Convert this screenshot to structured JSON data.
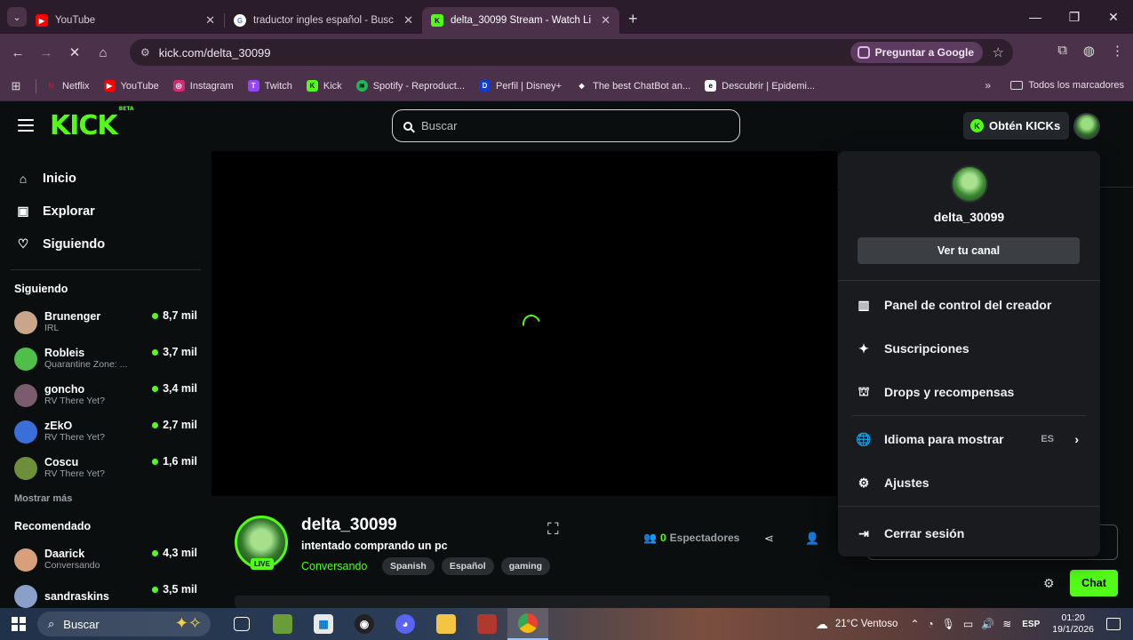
{
  "browser": {
    "tabs": [
      {
        "title": "YouTube",
        "icon": "youtube-icon",
        "color": "#ff0000",
        "active": false
      },
      {
        "title": "traductor ingles español - Busc",
        "icon": "google-icon",
        "color": "#4285f4",
        "active": false
      },
      {
        "title": "delta_30099 Stream - Watch Li",
        "icon": "kick-icon",
        "color": "#53fc18",
        "active": true
      }
    ],
    "new_tab": "+",
    "url": "kick.com/delta_30099",
    "ask_google": "Preguntar a Google",
    "bookmarks": [
      {
        "label": "Netflix",
        "icon": "netflix-icon",
        "color": "#e50914"
      },
      {
        "label": "YouTube",
        "icon": "youtube-icon",
        "color": "#ff0000"
      },
      {
        "label": "Instagram",
        "icon": "instagram-icon",
        "color": "#d62976"
      },
      {
        "label": "Twitch",
        "icon": "twitch-icon",
        "color": "#9146ff"
      },
      {
        "label": "Kick",
        "icon": "kick-icon",
        "color": "#53fc18"
      },
      {
        "label": "Spotify - Reproduct...",
        "icon": "spotify-icon",
        "color": "#1db954"
      },
      {
        "label": "Perfil | Disney+",
        "icon": "disney-icon",
        "color": "#113ccf"
      },
      {
        "label": "The best ChatBot an...",
        "icon": "chatbot-icon",
        "color": "#ffffff"
      },
      {
        "label": "Descubrir | Epidemi...",
        "icon": "epidemic-icon",
        "color": "#ffffff"
      }
    ],
    "all_bookmarks": "Todos los marcadores"
  },
  "kick": {
    "search_placeholder": "Buscar",
    "get_kicks": "Obtén KICKs",
    "nav": [
      {
        "label": "Inicio",
        "icon": "home-icon"
      },
      {
        "label": "Explorar",
        "icon": "browse-icon"
      },
      {
        "label": "Siguiendo",
        "icon": "heart-icon"
      }
    ],
    "following_heading": "Siguiendo",
    "following": [
      {
        "name": "Brunenger",
        "sub": "IRL",
        "viewers": "8,7 mil",
        "avatar_color": "#c9a58a"
      },
      {
        "name": "Robleis",
        "sub": "Quarantine Zone: ...",
        "viewers": "3,7 mil",
        "avatar_color": "#4fbf4a"
      },
      {
        "name": "goncho",
        "sub": "RV There Yet?",
        "viewers": "3,4 mil",
        "avatar_color": "#7a5c6e"
      },
      {
        "name": "zEkO",
        "sub": "RV There Yet?",
        "viewers": "2,7 mil",
        "avatar_color": "#3a6fd8"
      },
      {
        "name": "Coscu",
        "sub": "RV There Yet?",
        "viewers": "1,6 mil",
        "avatar_color": "#6e8f3a"
      }
    ],
    "show_more": "Mostrar más",
    "recommended_heading": "Recomendado",
    "recommended": [
      {
        "name": "Daarick",
        "sub": "Conversando",
        "viewers": "4,3 mil",
        "avatar_color": "#d8a07a"
      },
      {
        "name": "sandraskins",
        "sub": "",
        "viewers": "3,5 mil",
        "avatar_color": "#8aa0c8"
      }
    ],
    "stream": {
      "streamer": "delta_30099",
      "title": "intentado comprando un pc",
      "category": "Conversando",
      "tags": [
        "Spanish",
        "Español",
        "gaming"
      ],
      "live": "LIVE",
      "viewer_count": "0",
      "viewer_label": "Espectadores"
    },
    "chat_button": "Chat",
    "menu": {
      "username": "delta_30099",
      "view_channel": "Ver tu canal",
      "items": [
        {
          "label": "Panel de control del creador",
          "icon": "dashboard-icon"
        },
        {
          "label": "Suscripciones",
          "icon": "sparkle-icon"
        },
        {
          "label": "Drops y recompensas",
          "icon": "gift-icon"
        },
        {
          "label": "Idioma para mostrar",
          "icon": "globe-icon",
          "value": "ES"
        },
        {
          "label": "Ajustes",
          "icon": "gear-icon"
        },
        {
          "label": "Cerrar sesión",
          "icon": "logout-icon"
        }
      ]
    }
  },
  "taskbar": {
    "search": "Buscar",
    "weather": "21°C  Ventoso",
    "lang": "ESP",
    "time": "01:20",
    "date": "19/1/2026"
  }
}
